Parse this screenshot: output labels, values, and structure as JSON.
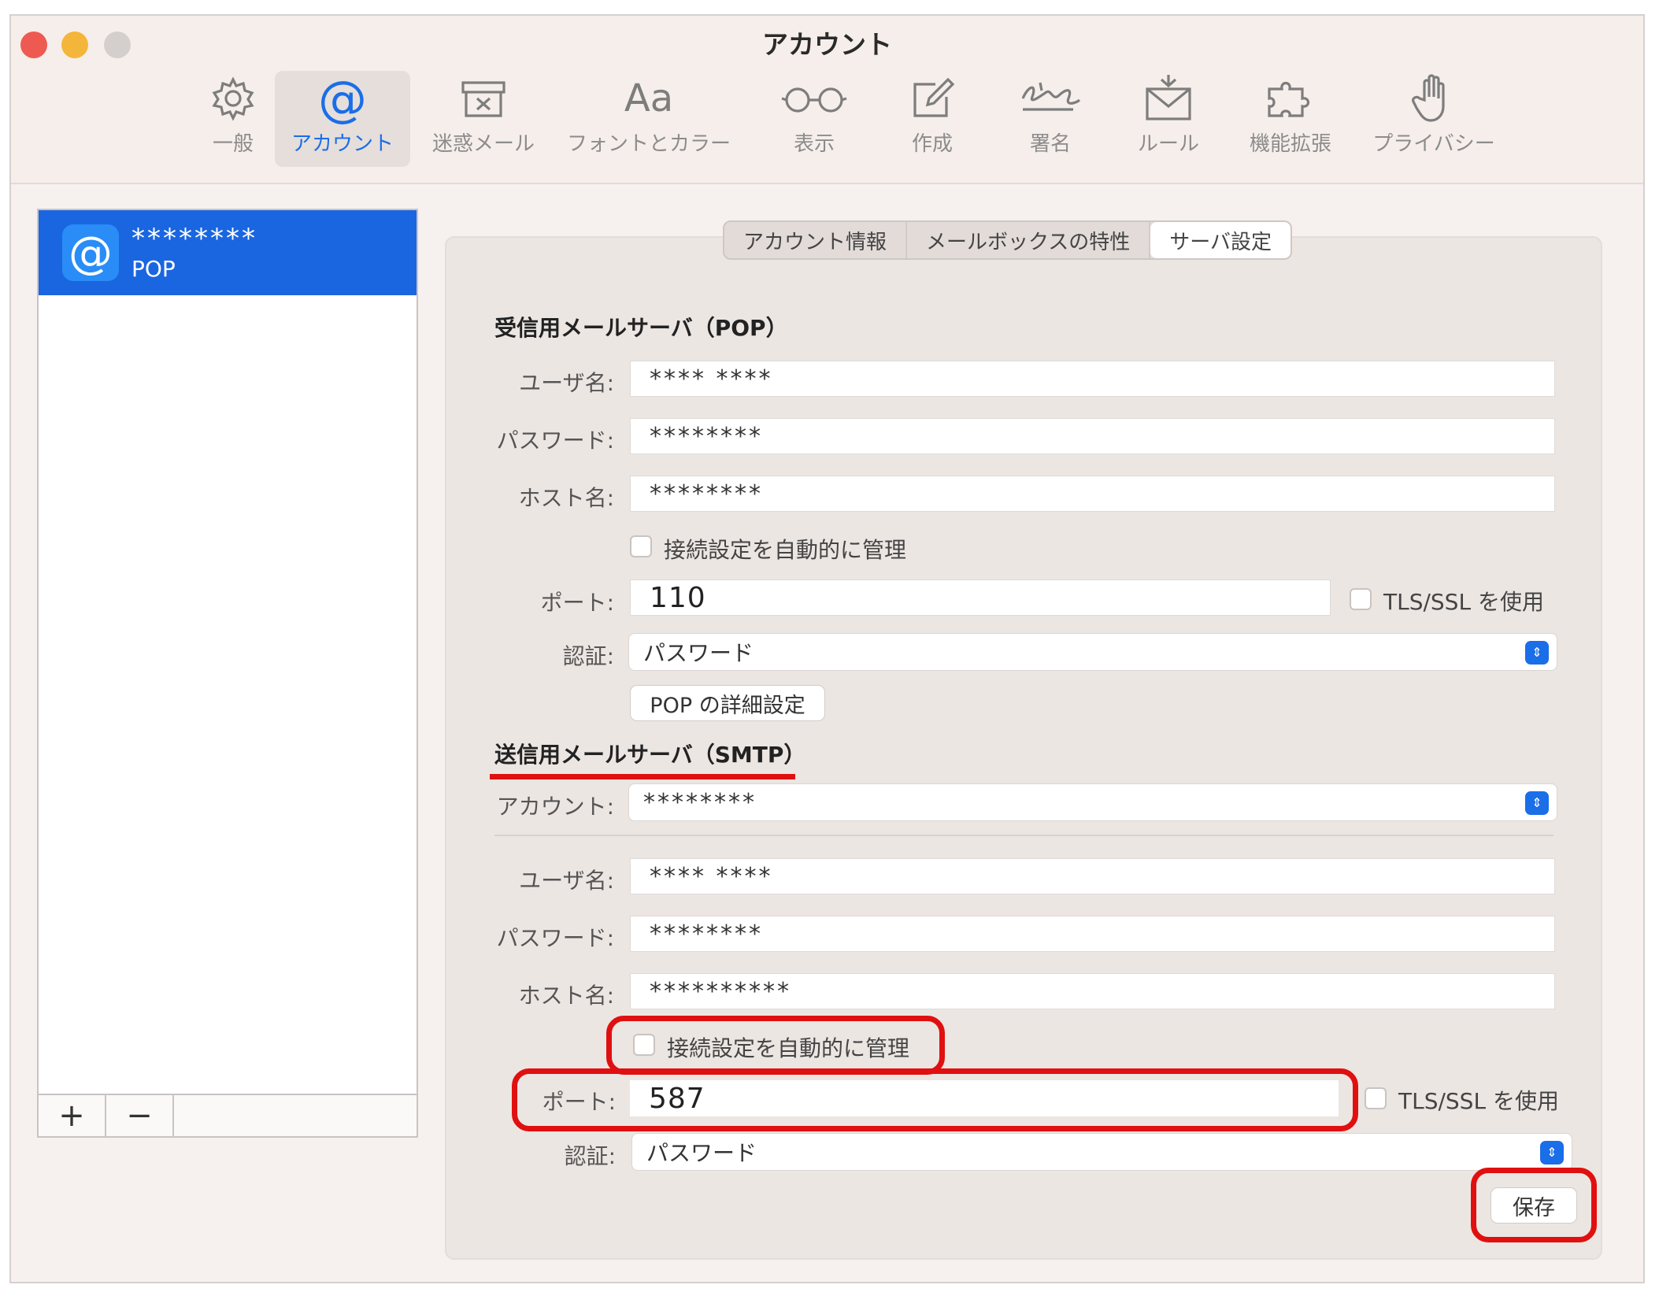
{
  "window": {
    "title": "アカウント"
  },
  "toolbar": {
    "items": [
      {
        "label": "一般",
        "icon": "gear-icon"
      },
      {
        "label": "アカウント",
        "icon": "at-icon"
      },
      {
        "label": "迷惑メール",
        "icon": "junk-box-icon"
      },
      {
        "label": "フォントとカラー",
        "icon": "font-icon",
        "glyph": "Aa"
      },
      {
        "label": "表示",
        "icon": "glasses-icon"
      },
      {
        "label": "作成",
        "icon": "compose-icon"
      },
      {
        "label": "署名",
        "icon": "signature-icon"
      },
      {
        "label": "ルール",
        "icon": "rules-envelope-icon"
      },
      {
        "label": "機能拡張",
        "icon": "puzzle-icon"
      },
      {
        "label": "プライバシー",
        "icon": "hand-icon"
      }
    ],
    "active": "アカウント"
  },
  "sidebar": {
    "account": {
      "name": "********",
      "type": "POP",
      "icon_glyph": "@"
    },
    "add_label": "+",
    "remove_label": "−"
  },
  "tabs": {
    "items": [
      "アカウント情報",
      "メールボックスの特性",
      "サーバ設定"
    ],
    "selected": "サーバ設定"
  },
  "incoming": {
    "section_title": "受信用メールサーバ（POP）",
    "username_label": "ユーザ名:",
    "username_value": "**** ****",
    "password_label": "パスワード:",
    "password_value": "********",
    "host_label": "ホスト名:",
    "host_value": "********",
    "auto_manage_label": "接続設定を自動的に管理",
    "auto_manage_checked": false,
    "port_label": "ポート:",
    "port_value": "110",
    "tls_label": "TLS/SSL を使用",
    "tls_checked": false,
    "auth_label": "認証:",
    "auth_value": "パスワード",
    "advanced_button": "POP の詳細設定"
  },
  "outgoing": {
    "section_title": "送信用メールサーバ（SMTP）",
    "account_label": "アカウント:",
    "account_value": "********",
    "username_label": "ユーザ名:",
    "username_value": "**** ****",
    "password_label": "パスワード:",
    "password_value": "********",
    "host_label": "ホスト名:",
    "host_value": "**********",
    "auto_manage_label": "接続設定を自動的に管理",
    "auto_manage_checked": false,
    "port_label": "ポート:",
    "port_value": "587",
    "tls_label": "TLS/SSL を使用",
    "tls_checked": false,
    "auth_label": "認証:",
    "auth_value": "パスワード"
  },
  "save_button": "保存",
  "colors": {
    "accent": "#1a6ee8",
    "selection": "#1a66e0",
    "highlight_red": "#e01010"
  }
}
